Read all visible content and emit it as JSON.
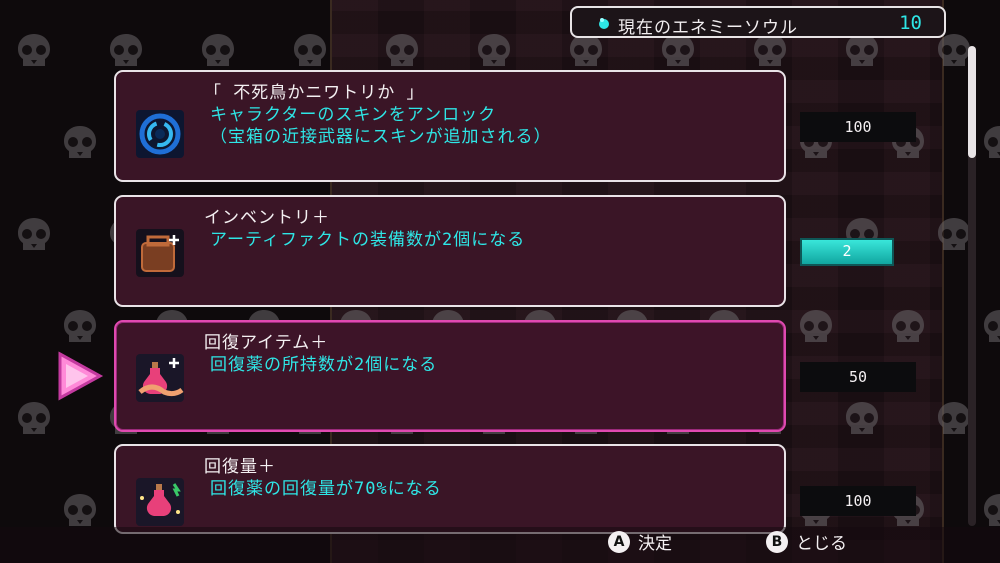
{
  "soul_counter": {
    "label": "現在のエネミーソウル",
    "value": "10"
  },
  "items": [
    {
      "title": "「 不死鳥かニワトリか 」",
      "desc": "キャラクターのスキンをアンロック\n（宝箱の近接武器にスキンが追加される）",
      "icon": "vortex-icon",
      "cost": "100"
    },
    {
      "title": "インベントリ＋",
      "desc": "アーティファクトの装備数が2個になる",
      "icon": "backpack-icon",
      "level": "2",
      "level_progress": 1.0
    },
    {
      "title": "回復アイテム＋",
      "desc": "回復薬の所持数が2個になる",
      "icon": "potion-hand-icon",
      "cost": "50",
      "selected": true
    },
    {
      "title": "回復量＋",
      "desc": "回復薬の回復量が70%になる",
      "icon": "potion-sparkle-icon",
      "cost": "100"
    }
  ],
  "footer": {
    "confirm_key": "A",
    "confirm_label": "決定",
    "close_key": "B",
    "close_label": "とじる"
  },
  "colors": {
    "accent": "#2ee6e6",
    "selected_border": "#e04ab0",
    "panel": "#3a1526"
  }
}
